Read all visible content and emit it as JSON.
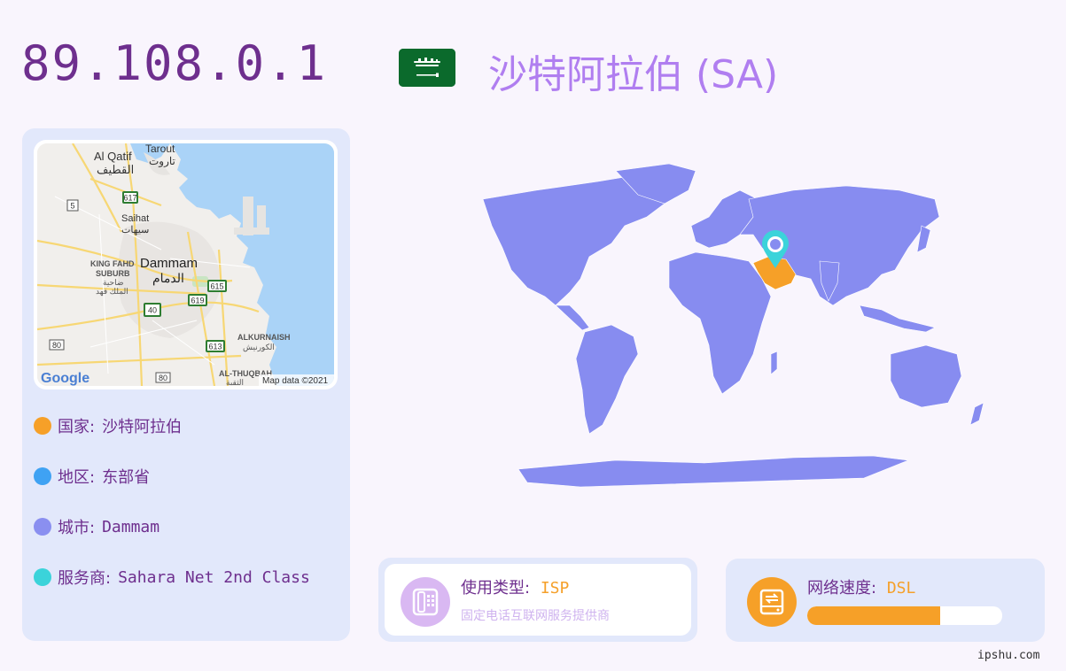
{
  "ip": "89.108.0.1",
  "country_title": "沙特阿拉伯 (SA)",
  "flag": {
    "icon": "saudi-arabia-flag-icon",
    "color": "#0b6a2c"
  },
  "map": {
    "labels": {
      "al_qatif": "Al Qatif",
      "al_qatif_ar": "القطيف",
      "tarout": "Tarout",
      "tarout_ar": "تاروت",
      "saihat": "Saihat",
      "saihat_ar": "سيهات",
      "king_fahd_1": "KING FAHD",
      "king_fahd_2": "SUBURB",
      "king_fahd_ar1": "ضاحية",
      "king_fahd_ar2": "الملك فهد",
      "dammam": "Dammam",
      "dammam_ar": "الدمام",
      "alkurnaish": "ALKURNAISH",
      "alkurnaish_ar": "الكورنيش",
      "althuqbah": "AL-THUQBAH",
      "althuqbah_ar": "الثقبة",
      "google": "Google",
      "attribution": "Map data ©2021"
    },
    "shields": {
      "r617": "617",
      "r5": "5",
      "r615": "615",
      "r619": "619",
      "r40": "40",
      "r613": "613",
      "r80a": "80",
      "r80b": "80"
    }
  },
  "info": [
    {
      "label": "国家:",
      "value": "沙特阿拉伯",
      "color": "#f6a028"
    },
    {
      "label": "地区:",
      "value": "东部省",
      "color": "#3fa2f3"
    },
    {
      "label": "城市:",
      "value": "Dammam",
      "color": "#8a8ff0"
    },
    {
      "label": "服务商:",
      "value": "Sahara Net 2nd Class",
      "color": "#3bd3da"
    }
  ],
  "usage": {
    "title": "使用类型:",
    "value": "ISP",
    "subtitle": "固定电话互联网服务提供商",
    "icon": "phone-icon",
    "icon_color": "#d9b8f2"
  },
  "speed": {
    "title": "网络速度:",
    "value": "DSL",
    "icon": "router-icon",
    "icon_color": "#f6a028",
    "level": 0.68
  },
  "footer": "ipshu.com"
}
